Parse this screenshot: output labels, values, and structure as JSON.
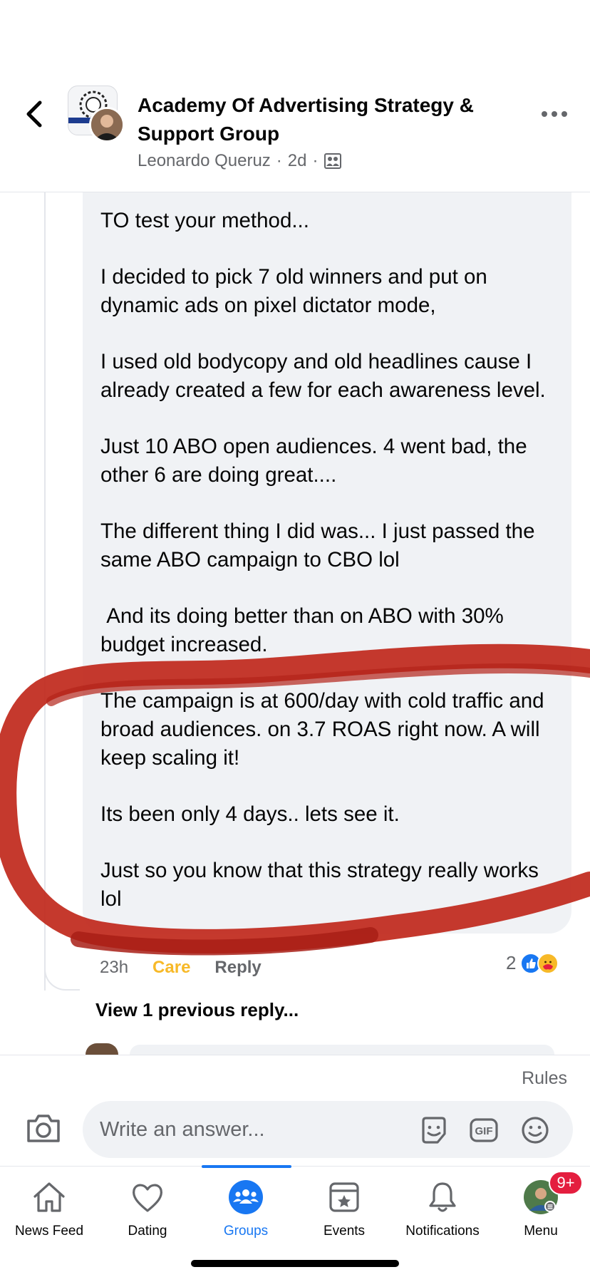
{
  "header": {
    "group_title": "Academy Of Advertising Strategy & Support Group",
    "author": "Leonardo Queruz",
    "time_ago": "2d",
    "separator": "·"
  },
  "comment": {
    "paragraphs": [
      "TO test your method...",
      "I decided to pick 7 old winners and put on dynamic ads on pixel dictator mode,",
      "I used old bodycopy and old headlines cause I already created a few for each awareness level.",
      "Just 10 ABO open audiences. 4 went bad, the other 6 are doing great....",
      "The different thing I did was... I just passed the same ABO campaign to CBO lol",
      " And its doing better than on ABO with 30% budget increased.",
      "The campaign is at 600/day with cold traffic and broad audiences. on 3.7 ROAS right now. A will keep scaling it!",
      "Its been only 4 days.. lets see it.",
      "Just so you know that this strategy really works lol"
    ],
    "time": "23h",
    "reaction_label": "Care",
    "reply_label": "Reply",
    "reaction_count": "2",
    "reaction_icons": [
      "like-icon",
      "care-icon"
    ]
  },
  "thread": {
    "view_previous_label": "View 1 previous reply..."
  },
  "composer": {
    "rules_label": "Rules",
    "placeholder": "Write an answer...",
    "icons": [
      "camera-icon",
      "sticker-icon",
      "gif-icon",
      "emoji-icon"
    ],
    "gif_label": "GIF"
  },
  "nav": {
    "items": [
      {
        "label": "News Feed",
        "icon": "home-icon"
      },
      {
        "label": "Dating",
        "icon": "heart-icon"
      },
      {
        "label": "Groups",
        "icon": "groups-icon"
      },
      {
        "label": "Events",
        "icon": "calendar-star-icon"
      },
      {
        "label": "Notifications",
        "icon": "bell-icon"
      },
      {
        "label": "Menu",
        "icon": "profile-avatar-icon"
      }
    ],
    "active": "Groups",
    "menu_badge": "9+"
  },
  "colors": {
    "accent": "#1877f2",
    "bubble": "#f0f2f5",
    "secondary_text": "#65676b",
    "care": "#f7b928",
    "badge": "#e41e3f",
    "annotation": "#c0281b"
  }
}
